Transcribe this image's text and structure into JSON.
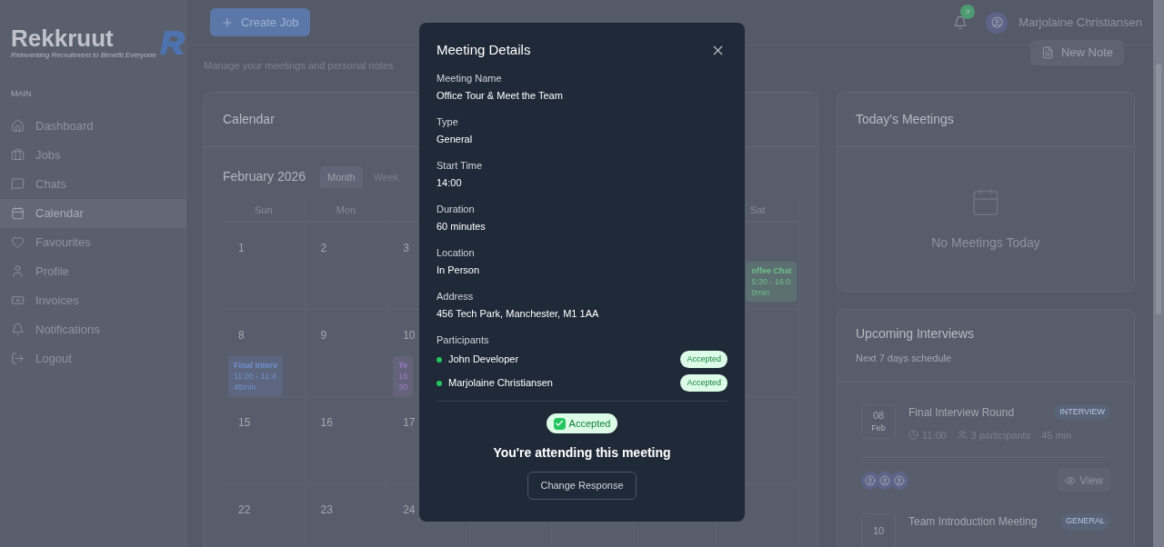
{
  "sidebar": {
    "logo": {
      "name": "Rekkruut",
      "tagline": "Reinventing Recruitment to Benefit Everyone"
    },
    "section": "MAIN",
    "items": [
      {
        "label": "Dashboard",
        "selected": false
      },
      {
        "label": "Jobs",
        "selected": false
      },
      {
        "label": "Chats",
        "selected": false
      },
      {
        "label": "Calendar",
        "selected": true
      },
      {
        "label": "Favourites",
        "selected": false
      },
      {
        "label": "Profile",
        "selected": false
      },
      {
        "label": "Invoices",
        "selected": false
      },
      {
        "label": "Notifications",
        "selected": false
      },
      {
        "label": "Logout",
        "selected": false
      }
    ]
  },
  "header": {
    "create_button": "Create Job",
    "notification_count": "0",
    "user_name": "Marjolaine Christiansen"
  },
  "page": {
    "subtitle": "Manage your meetings and personal notes",
    "new_note_button": "New Note"
  },
  "calendar": {
    "title": "Calendar",
    "month": "February 2026",
    "views": [
      {
        "label": "Month",
        "selected": true
      },
      {
        "label": "Week",
        "selected": false
      }
    ],
    "weekdays_left": [
      "Sun",
      "Mon"
    ],
    "weekday_last": "Sat",
    "weeks": [
      {
        "days": [
          {
            "day": "1"
          },
          {
            "day": "2"
          },
          {
            "day": "3"
          }
        ],
        "saturday": {
          "event": {
            "title": "offee Chat",
            "time": "5:30 - 16:0",
            "duration": "0min",
            "color": "#6fbf8a"
          }
        }
      },
      {
        "days": [
          {
            "day": "8",
            "event": {
              "title": "Final Interv",
              "time": "11:00 - 11:4",
              "duration": "45min",
              "color": "#6f8fd0"
            }
          },
          {
            "day": "9"
          },
          {
            "day": "10",
            "event": {
              "title": "Te",
              "time": "15",
              "duration": "30",
              "color": "#9a7cc4"
            }
          }
        ]
      },
      {
        "days": [
          {
            "day": "15"
          },
          {
            "day": "16"
          },
          {
            "day": "17"
          }
        ]
      },
      {
        "days": [
          {
            "day": "22"
          },
          {
            "day": "23"
          },
          {
            "day": "24"
          }
        ]
      }
    ]
  },
  "todays_meetings": {
    "title": "Today's Meetings",
    "empty_text": "No Meetings Today"
  },
  "upcoming": {
    "title": "Upcoming Interviews",
    "subtitle": "Next 7 days schedule",
    "items": [
      {
        "day": "08",
        "month": "Feb",
        "title": "Final Interview Round",
        "type": "INTERVIEW",
        "time": "11:00",
        "participants": "3 participants",
        "duration": "45 min",
        "view_button": "View"
      },
      {
        "day": "10",
        "title": "Team Introduction Meeting",
        "type": "GENERAL"
      }
    ]
  },
  "modal": {
    "title": "Meeting Details",
    "fields": [
      {
        "label": "Meeting Name",
        "value": "Office Tour & Meet the Team"
      },
      {
        "label": "Type",
        "value": "General"
      },
      {
        "label": "Start Time",
        "value": "14:00"
      },
      {
        "label": "Duration",
        "value": "60 minutes"
      },
      {
        "label": "Location",
        "value": "In Person"
      },
      {
        "label": "Address",
        "value": "456 Tech Park, Manchester, M1 1AA"
      }
    ],
    "participants_label": "Participants",
    "participants": [
      {
        "name": "John Developer",
        "status": "Accepted",
        "color": "#22c55e"
      },
      {
        "name": "Marjolaine Christiansen",
        "status": "Accepted",
        "color": "#22c55e"
      }
    ],
    "response": {
      "status": "Accepted",
      "message": "You're attending this meeting",
      "button": "Change Response"
    }
  }
}
